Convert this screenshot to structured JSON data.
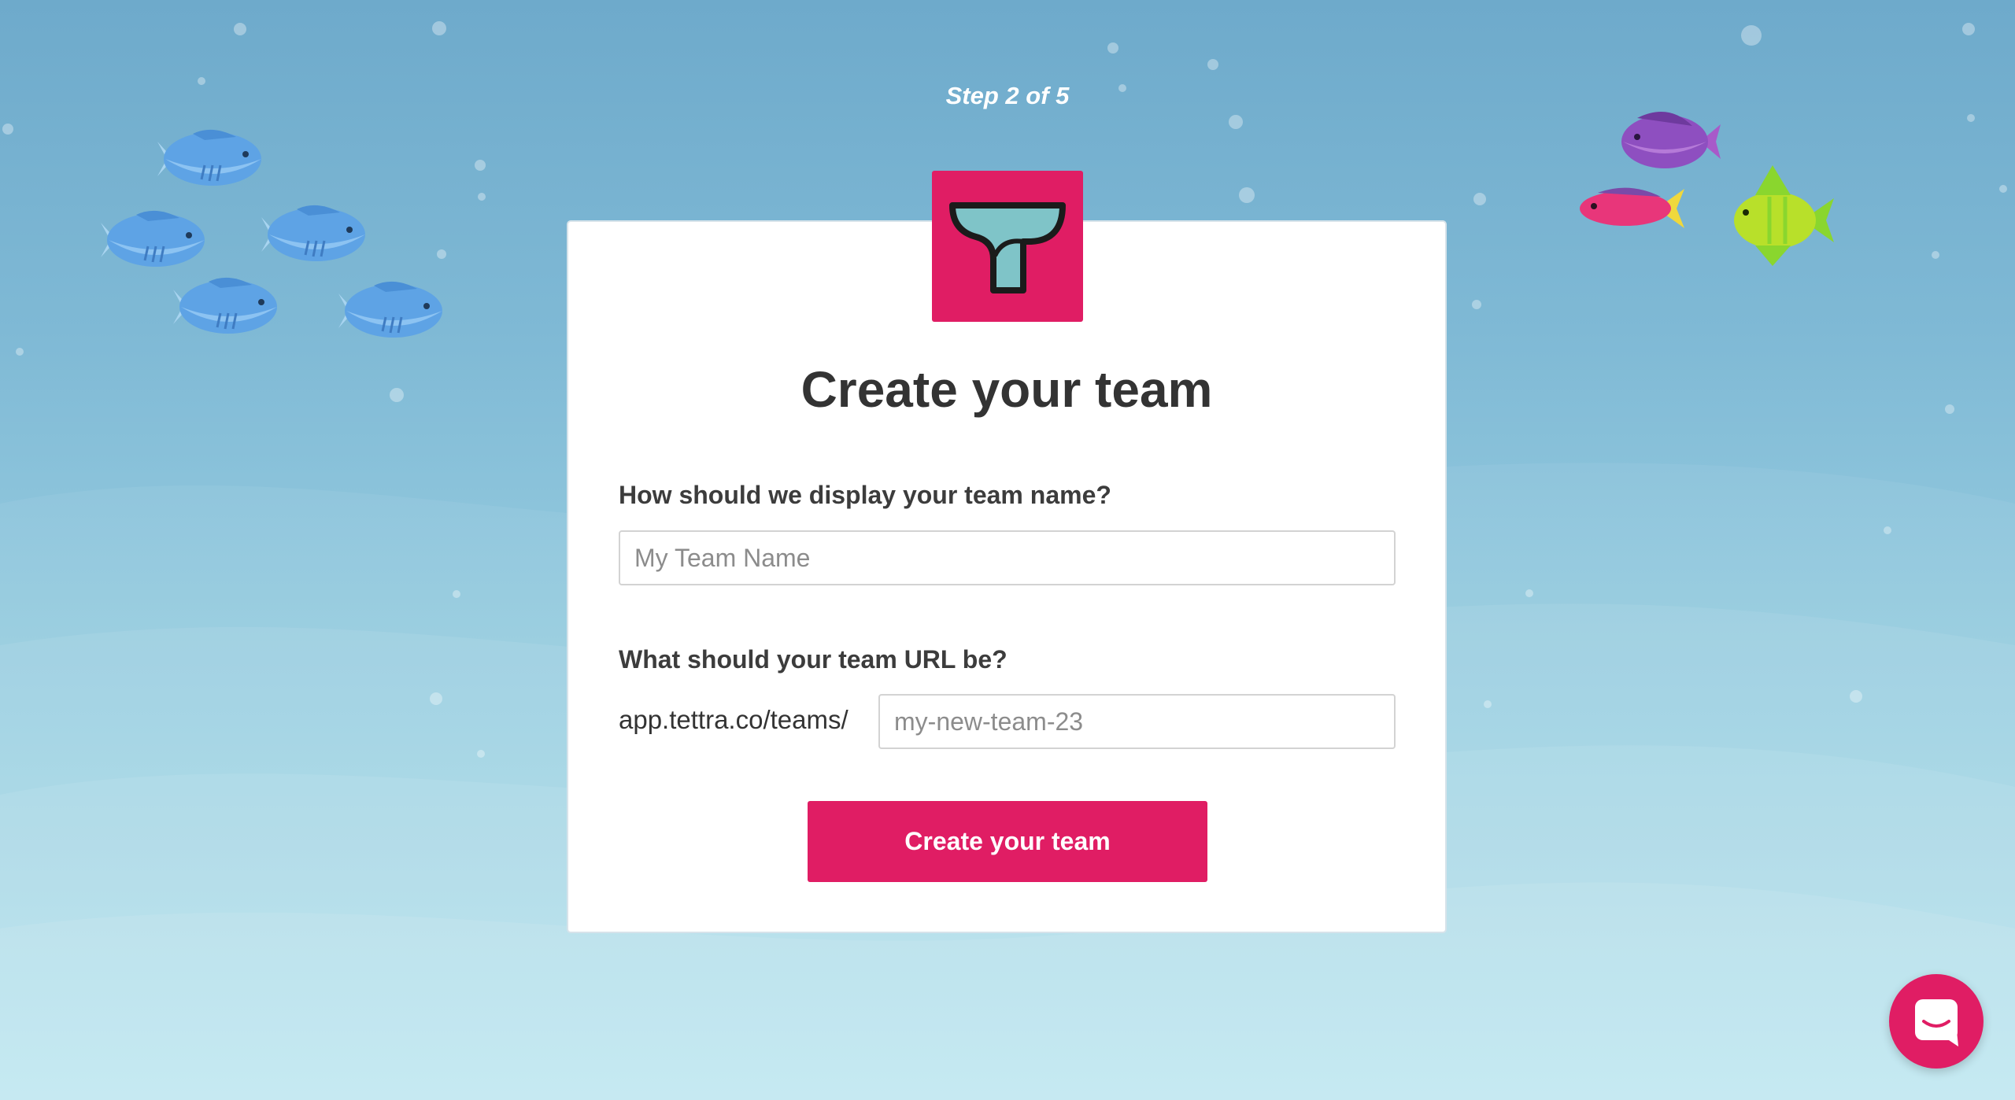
{
  "step": "Step 2 of 5",
  "title": "Create your team",
  "team_name": {
    "label": "How should we display your team name?",
    "placeholder": "My Team Name",
    "value": ""
  },
  "team_url": {
    "label": "What should your team URL be?",
    "prefix": "app.tettra.co/teams/",
    "placeholder": "my-new-team-23",
    "value": ""
  },
  "submit_label": "Create your team",
  "colors": {
    "brand": "#e01d64",
    "background_top": "#6eaacb",
    "background_bottom": "#b3e3ee",
    "logo_mark": "#7fc4c8"
  },
  "icons": {
    "logo": "tettra-logo-icon",
    "chat": "chat-bubble-icon",
    "fish": "fish-icon"
  }
}
